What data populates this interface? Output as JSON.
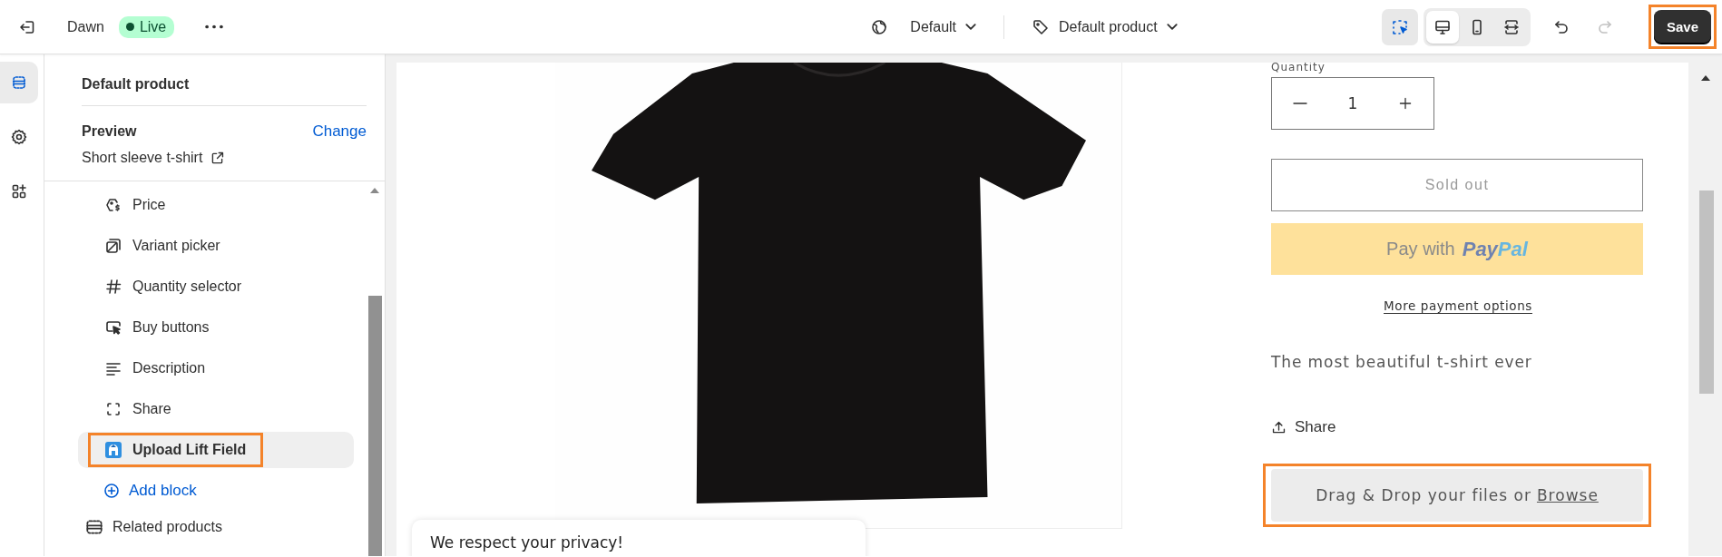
{
  "topbar": {
    "theme_name": "Dawn",
    "status_badge": "Live",
    "template": "Default",
    "page": "Default product",
    "inspector": {
      "selected": true
    },
    "devices": [
      {
        "kind": "desktop",
        "selected": true
      },
      {
        "kind": "mobile",
        "selected": false
      },
      {
        "kind": "fullwidth",
        "selected": false
      }
    ],
    "redo": {
      "disabled": true
    },
    "save": {
      "label": "Save",
      "highlighted": true
    }
  },
  "rail": [
    {
      "kind": "sections",
      "selected": true
    },
    {
      "kind": "settings",
      "selected": false
    },
    {
      "kind": "apps",
      "selected": false
    }
  ],
  "sidebar": {
    "title": "Default product",
    "preview_label": "Preview",
    "change_link": "Change",
    "preview_product": "Short sleeve t-shirt",
    "blocks": [
      {
        "kind": "price",
        "label": "Price",
        "selected": false,
        "highlighted": false
      },
      {
        "kind": "variant",
        "label": "Variant picker",
        "selected": false,
        "highlighted": false
      },
      {
        "kind": "quantity",
        "label": "Quantity selector",
        "selected": false,
        "highlighted": false
      },
      {
        "kind": "buy",
        "label": "Buy buttons",
        "selected": false,
        "highlighted": false
      },
      {
        "kind": "description",
        "label": "Description",
        "selected": false,
        "highlighted": false
      },
      {
        "kind": "share",
        "label": "Share",
        "selected": false,
        "highlighted": false
      },
      {
        "kind": "app",
        "label": "Upload Lift Field",
        "selected": true,
        "highlighted": true
      }
    ],
    "add_block": "Add block",
    "next_section": "Related products"
  },
  "preview": {
    "quantity_label": "Quantity",
    "quantity_value": "1",
    "sold_out": "Sold out",
    "paypal": {
      "prefix": "Pay with",
      "brand_part_1": "Pay",
      "brand_part_2": "Pal"
    },
    "more_payment_options": "More payment options",
    "description": "The most beautiful t-shirt ever",
    "share": "Share",
    "upload_field": {
      "text": "Drag & Drop your files or",
      "link": "Browse",
      "highlighted": true
    },
    "privacy_notice": "We respect your privacy!"
  }
}
